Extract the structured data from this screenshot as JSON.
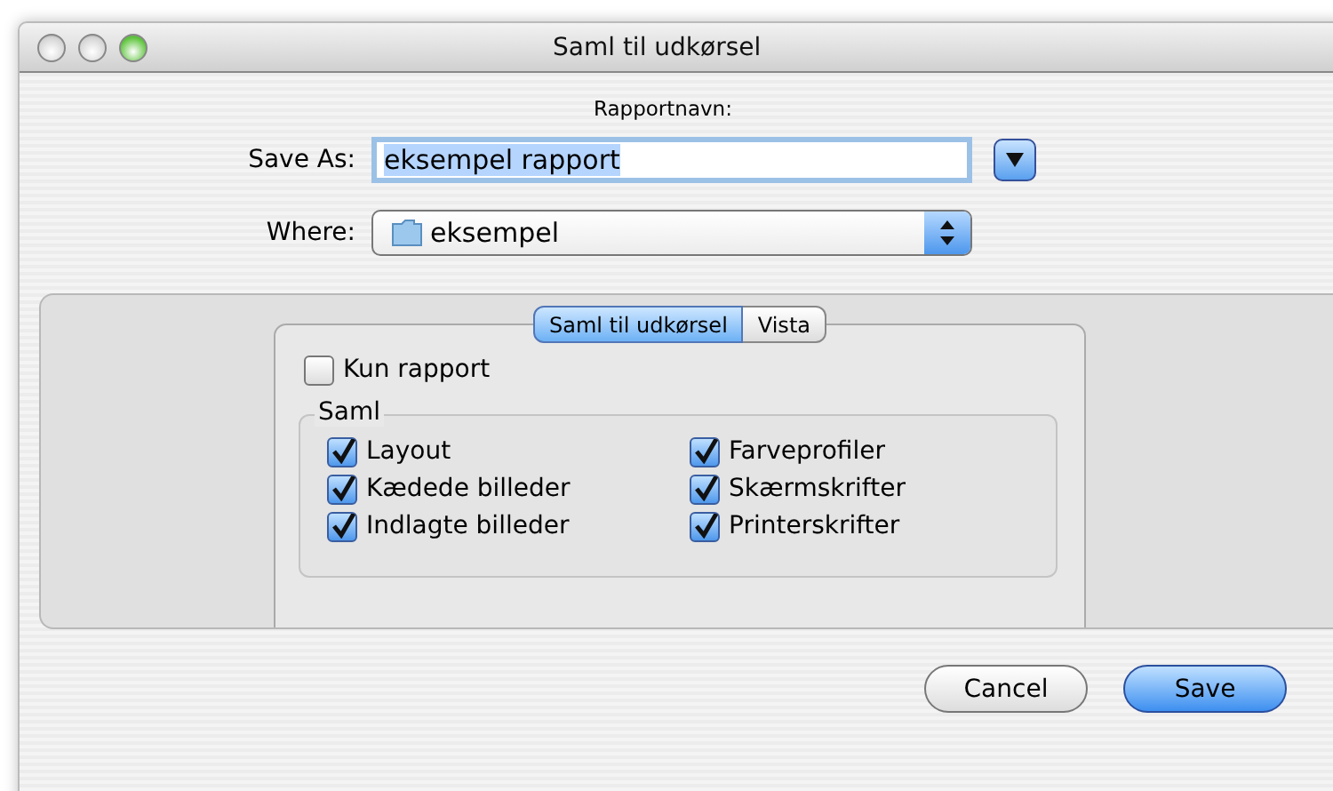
{
  "window": {
    "title": "Saml til udkørsel",
    "controls": [
      {
        "kind": "close"
      },
      {
        "kind": "minimize"
      },
      {
        "kind": "zoom"
      }
    ]
  },
  "heading": "Rapportnavn:",
  "save_as": {
    "label": "Save As:",
    "value": "eksempel rapport"
  },
  "where": {
    "label": "Where:",
    "value": "eksempel"
  },
  "tabs": [
    {
      "label": "Saml til udkørsel",
      "selected": true
    },
    {
      "label": "Vista",
      "selected": false
    }
  ],
  "report_only": {
    "label": "Kun rapport",
    "checked": false
  },
  "collect": {
    "title": "Saml",
    "items": [
      {
        "label": "Layout",
        "checked": true
      },
      {
        "label": "Kædede billeder",
        "checked": true
      },
      {
        "label": "Indlagte billeder",
        "checked": true
      },
      {
        "label": "Farveprofiler",
        "checked": true
      },
      {
        "label": "Skærmskrifter",
        "checked": true
      },
      {
        "label": "Printerskrifter",
        "checked": true
      }
    ]
  },
  "buttons": [
    {
      "label": "Cancel",
      "kind": "secondary"
    },
    {
      "label": "Save",
      "kind": "default"
    }
  ]
}
